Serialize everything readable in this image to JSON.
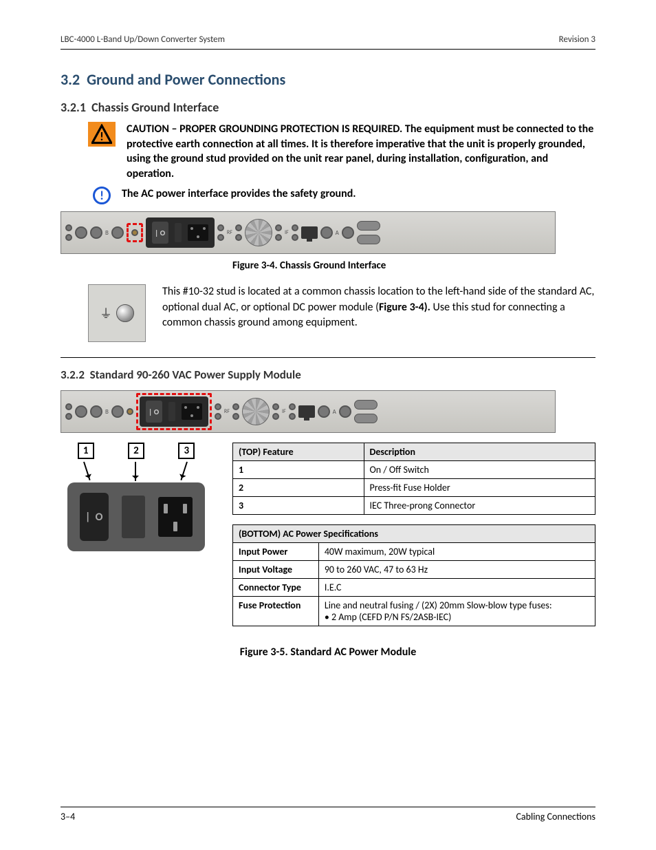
{
  "header": {
    "left": "LBC-4000 L-Band Up/Down Converter System",
    "right": "Revision 3"
  },
  "sec3_2": {
    "num": "3.2",
    "title": "Ground and Power Connections"
  },
  "sec3_2_1": {
    "num": "3.2.1",
    "title": "Chassis Ground Interface"
  },
  "caution": "CAUTION – PROPER GROUNDING PROTECTION IS REQUIRED. The equipment must be connected to the protective earth connection at all times. It is therefore imperative that the unit is properly grounded, using the ground stud provided on the unit rear panel, during installation, configuration, and operation.",
  "info_note": "The AC power interface provides the safety ground.",
  "fig3_4_caption": "Figure 3-4. Chassis Ground Interface",
  "stud_text": {
    "pre": "This #10-32 stud is located at a common chassis location to the left-hand side of the standard AC, optional dual AC, or optional DC power module (",
    "bold": "Figure 3-4).",
    "post": " Use this stud for connecting a common chassis ground among equipment."
  },
  "sec3_2_2": {
    "num": "3.2.2",
    "title": "Standard 90-260 VAC Power Supply Module"
  },
  "callout": {
    "a": "1",
    "b": "2",
    "c": "3"
  },
  "features": {
    "title": "(TOP) Feature",
    "col2": "Description",
    "rows": [
      {
        "a": "1",
        "b": "On / Off Switch"
      },
      {
        "a": "2",
        "b": "Press-fit Fuse Holder"
      },
      {
        "a": "3",
        "b": "IEC Three-prong Connector"
      }
    ]
  },
  "specs": {
    "title": "(BOTTOM) AC Power Specifications",
    "rows": [
      {
        "a": "Input Power",
        "b": "40W maximum, 20W typical"
      },
      {
        "a": "Input Voltage",
        "b": "90 to 260 VAC, 47 to 63 Hz"
      },
      {
        "a": "Connector Type",
        "b": "I.E.C"
      },
      {
        "a": "Fuse Protection",
        "b": "Line and neutral fusing / (2X) 20mm Slow-blow type fuses:\n• 2 Amp (CEFD P/N FS/2ASB-IEC)"
      }
    ]
  },
  "fig3_5_caption": "Figure 3-5. Standard AC Power Module",
  "footer": {
    "left": "3–4",
    "right": "Cabling Connections"
  }
}
